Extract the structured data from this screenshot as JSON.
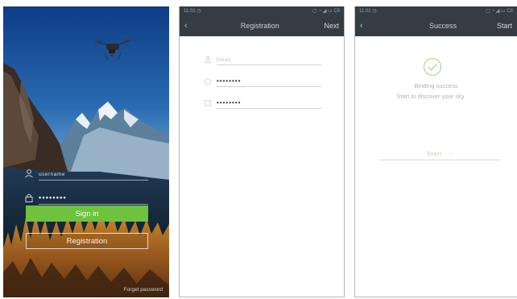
{
  "login": {
    "username_placeholder": "username",
    "password_value": "••••••••",
    "signin_label": "Sign in",
    "registration_label": "Registration",
    "forgot_label": "Forget password"
  },
  "registration": {
    "status_time": "11:01 ◷",
    "status_icons": "▢ ◔ ◢ ▭ C8",
    "back_glyph": "‹",
    "title": "Registration",
    "next_label": "Next",
    "email_placeholder": "Email",
    "password_value": "••••••••",
    "confirm_value": "••••••••"
  },
  "success": {
    "status_time": "11:01 ◷",
    "status_icons": "▢ ◔ ◢ ▭ C8",
    "back_glyph": "‹",
    "title": "Success",
    "start_header_label": "Start",
    "message_line1": "Binding success",
    "message_line2": "Start to discover your sky",
    "start_label": "Start",
    "start_chevron": "›"
  },
  "colors": {
    "accent_green": "#6fc23e",
    "header_bg": "#353c44"
  }
}
